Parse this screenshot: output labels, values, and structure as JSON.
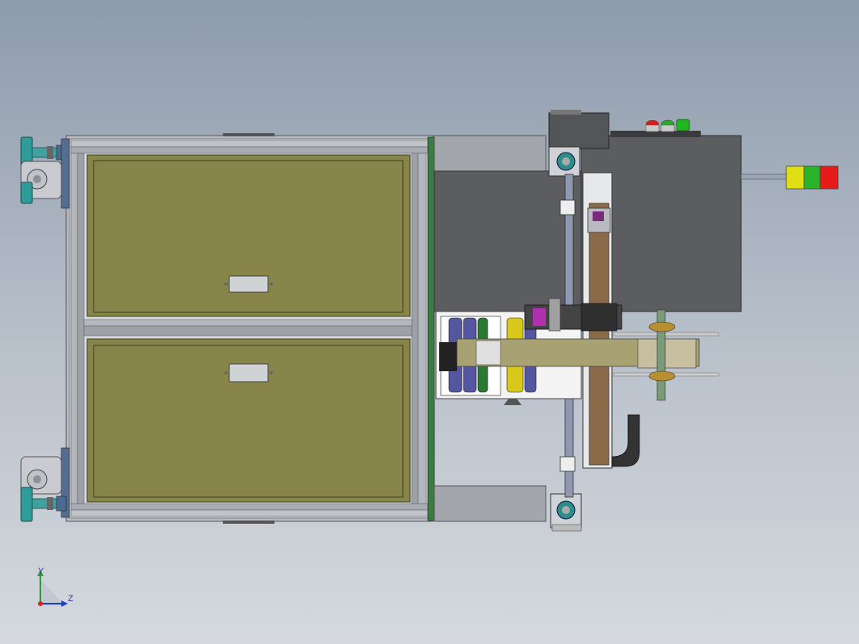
{
  "viewport": {
    "background_top": "#8e9bac",
    "background_bottom": "#d5d9de"
  },
  "colors": {
    "frame": "#c9cdd2",
    "frame_dark": "#6e737a",
    "drawer_panel": "#87854a",
    "drawer_border": "#4d4e2a",
    "green_strip": "#3d7a44",
    "machine_body": "#5b5d60",
    "machine_top": "#a3a6aa",
    "belt": "#8a6a48",
    "yellow": "#d8c81a",
    "blue_roller": "#5457a0",
    "magenta": "#b030b0",
    "teal": "#3a8d8a",
    "tan": "#b1a784",
    "light_red": "#e81b1b",
    "light_yellow": "#e2de14",
    "light_green": "#2ab42a"
  },
  "icons": {
    "triad": "xyz-triad-icon",
    "tower_light": "tower-light-icon",
    "caster": "caster-wheel-icon",
    "drawer_handle": "drawer-handle-icon"
  },
  "triad": {
    "y_label": "Y",
    "z_label": "Z"
  }
}
